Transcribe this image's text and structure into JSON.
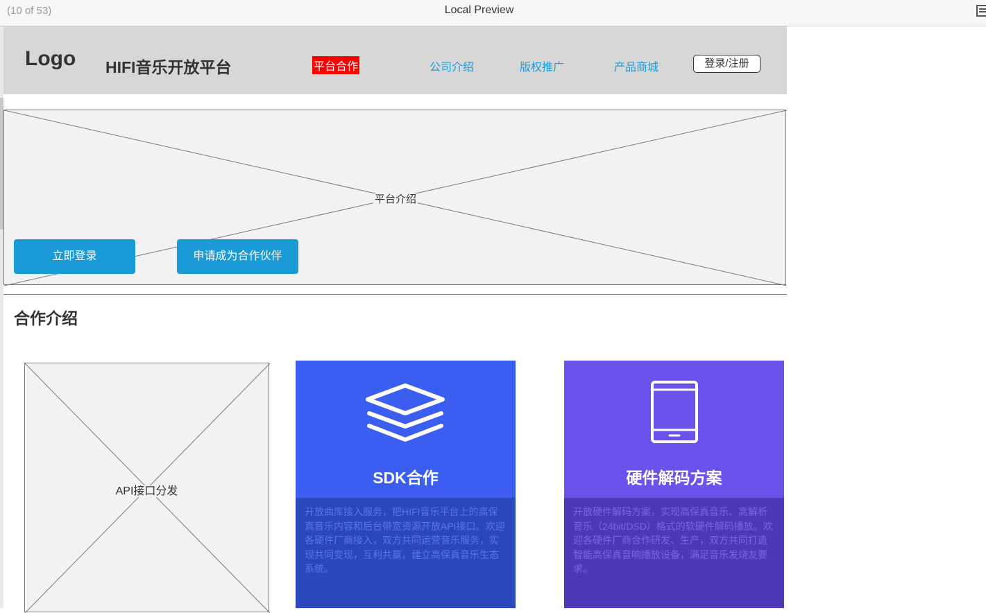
{
  "preview": {
    "page_counter": "(10 of 53)",
    "title": "Local Preview"
  },
  "header": {
    "logo": "Logo",
    "site_title": "HIFI音乐开放平台",
    "nav": [
      "平台合作",
      "公司介绍",
      "版权推广",
      "产品商城"
    ],
    "login_label": "登录/注册"
  },
  "hero": {
    "placeholder_label": "平台介绍",
    "login_button": "立即登录",
    "partner_button": "申请成为合作伙伴"
  },
  "section": {
    "title": "合作介绍"
  },
  "cards": {
    "api": {
      "placeholder_label": "API接口分发"
    },
    "sdk": {
      "icon": "layers-icon",
      "title": "SDK合作",
      "desc": "开放曲库接入服务，把HIFI音乐平台上的高保真音乐内容和后台带宽资源开放API接口。欢迎各硬件厂商接入，双方共同运营音乐服务，实现共同变现，互利共赢，建立高保真音乐生态系统。"
    },
    "hardware": {
      "icon": "tablet-icon",
      "title": "硬件解码方案",
      "desc": "开放硬件解码方案，实现高保真音乐、高解析音乐（24bit/DSD）格式的软硬件解码播放。欢迎各硬件厂商合作研发、生产，双方共同打造智能高保真音响播放设备，满足音乐发烧友要求。"
    }
  },
  "colors": {
    "nav_link": "#1e9bd7",
    "nav_active_bg": "#ff0000",
    "button_blue": "#1a9ad6",
    "sdk_top": "#3b5ef0",
    "sdk_bottom": "#2a47bb",
    "sdk_text": "#5a76e6",
    "hw_top": "#6b52eb",
    "hw_bottom": "#4c39b8",
    "hw_text": "#7b66e0"
  }
}
